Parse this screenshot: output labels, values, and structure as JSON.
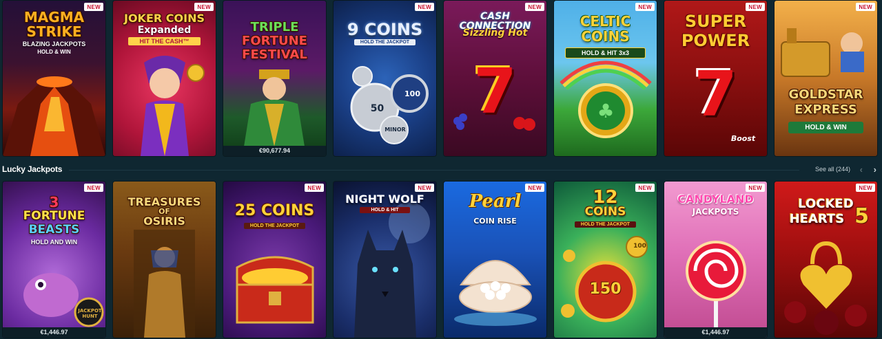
{
  "badge_label": "NEW",
  "top_row": [
    {
      "title_1": "MAGMA",
      "title_2": "STRIKE",
      "subtitle": "BLAZING JACKPOTS",
      "subtitle_2": "HOLD & WIN",
      "badge": true
    },
    {
      "title_1": "JOKER COINS",
      "title_2": "Expanded",
      "subtitle": "HIT THE CASH™",
      "badge": true
    },
    {
      "title_1": "TRIPLE",
      "title_2": "FORTUNE",
      "title_3": "FESTIVAL",
      "jackpot": "€90,677.94",
      "badge": false
    },
    {
      "title_1": "9 COINS",
      "subtitle": "HOLD THE JACKPOT",
      "coin_a": "50",
      "coin_b": "100",
      "coin_c": "MINOR",
      "badge": true
    },
    {
      "title_1": "CASH CONNECTION",
      "title_2": "Sizzling Hot",
      "symbol": "7",
      "badge": true
    },
    {
      "title_1": "CELTIC",
      "title_2": "COINS",
      "subtitle": "HOLD & HIT 3x3",
      "badge": true
    },
    {
      "title_1": "SUPER",
      "title_2": "POWER",
      "symbol": "7",
      "caption": "Boost",
      "badge": true
    },
    {
      "title_1": "GOLDSTAR",
      "title_2": "EXPRESS",
      "subtitle": "HOLD & WIN",
      "badge": true
    }
  ],
  "section": {
    "title": "Lucky Jackpots",
    "see_all": "See all (244)",
    "prev": "‹",
    "next": "›"
  },
  "bottom_row": [
    {
      "title_1": "3",
      "title_2": "FORTUNE",
      "title_3": "BEASTS",
      "subtitle": "HOLD AND WIN",
      "caption": "JACKPOT HUNT",
      "jackpot": "€1,446.97",
      "badge": true
    },
    {
      "title_1": "TREASURES",
      "title_2": "OF",
      "title_3": "OSIRIS",
      "badge": false
    },
    {
      "title_1": "25 COINS",
      "subtitle": "HOLD THE JACKPOT",
      "badge": true
    },
    {
      "title_1": "NIGHT WOLF",
      "subtitle": "HOLD & HIT",
      "badge": true
    },
    {
      "title_1": "Pearl",
      "title_2": "COIN RISE",
      "badge": true
    },
    {
      "title_1": "12",
      "title_2": "COINS",
      "subtitle": "HOLD THE JACKPOT",
      "coin_a": "150",
      "coin_b": "100",
      "badge": true
    },
    {
      "title_1": "CANDYLAND",
      "title_2": "JACKPOTS",
      "jackpot": "€1,446.97",
      "badge": true
    },
    {
      "title_1": "LOCKED",
      "title_2": "HEARTS",
      "title_3": "5",
      "badge": true
    }
  ]
}
